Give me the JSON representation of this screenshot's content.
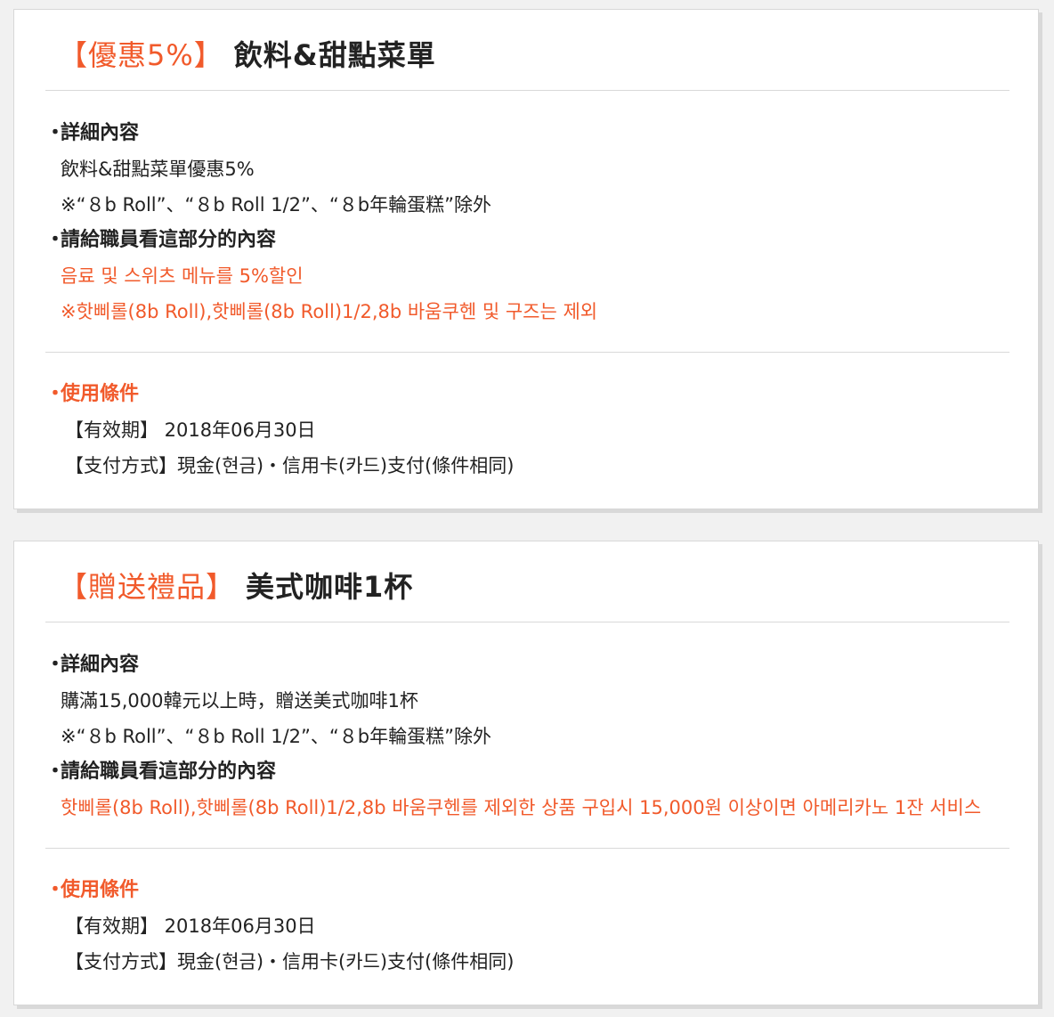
{
  "cards": [
    {
      "tag": "【優惠5%】",
      "name": "飲料&甜點菜單",
      "detail_heading": "詳細內容",
      "detail_lines": [
        "飲料&甜點菜單優惠5%",
        "※“８b Roll”、“８b Roll 1/2”、“８b年輪蛋糕”除外"
      ],
      "staff_heading": "請給職員看這部分的內容",
      "staff_lines": [
        "음료 및 스위츠 메뉴를 5%할인",
        "※핫삐롤(8b Roll),핫삐롤(8b Roll)1/2,8b 바움쿠헨 및 구즈는 제외"
      ],
      "cond_heading": "使用條件",
      "cond_lines": [
        "【有效期】 2018年06月30日",
        "【支付方式】現金(현금)・信用卡(카드)支付(條件相同)"
      ]
    },
    {
      "tag": "【贈送禮品】",
      "name": "美式咖啡1杯",
      "detail_heading": "詳細內容",
      "detail_lines": [
        "購滿15,000韓元以上時，贈送美式咖啡1杯",
        "※“８b Roll”、“８b Roll 1/2”、“８b年輪蛋糕”除外"
      ],
      "staff_heading": "請給職員看這部分的內容",
      "staff_lines": [
        "핫삐롤(8b Roll),핫삐롤(8b Roll)1/2,8b 바움쿠헨를 제외한 상품 구입시 15,000원 이상이면 아메리카노 1잔 서비스"
      ],
      "cond_heading": "使用條件",
      "cond_lines": [
        "【有效期】 2018年06月30日",
        "【支付方式】現金(현금)・信用卡(카드)支付(條件相同)"
      ]
    }
  ],
  "bullet": "・",
  "colors": {
    "accent": "#f15a2b",
    "text": "#222222",
    "divider": "#d9d9d9",
    "background": "#f1f1f1"
  }
}
